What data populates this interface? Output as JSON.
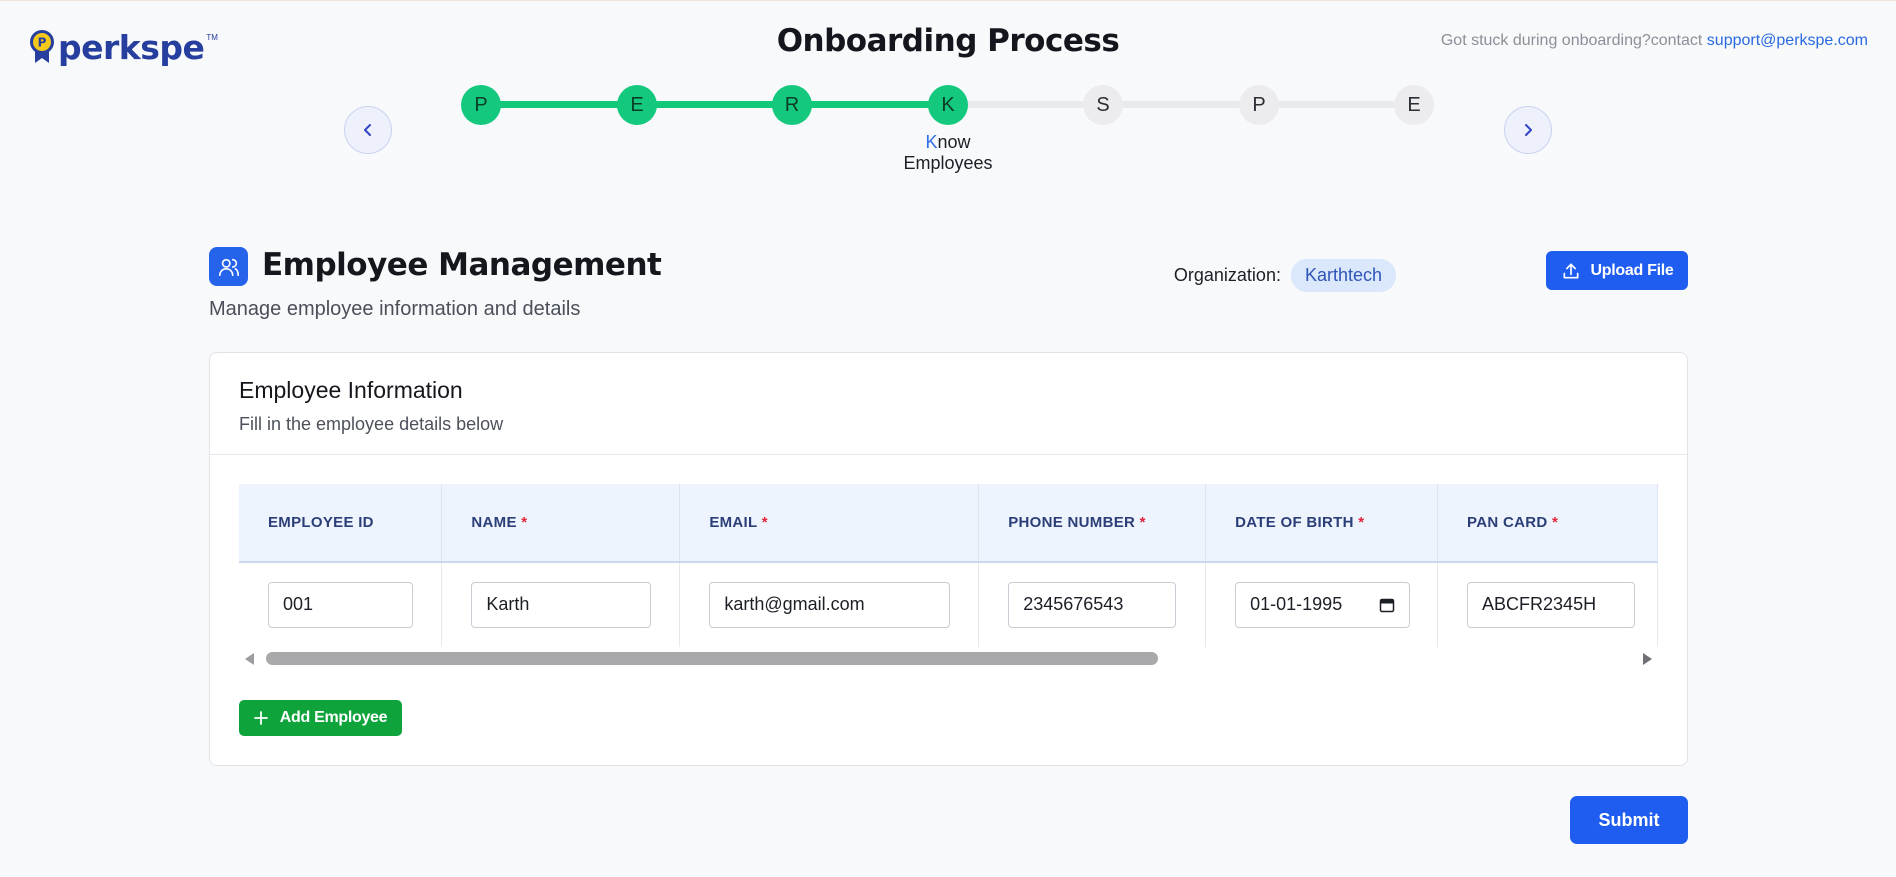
{
  "brand": {
    "logo_text": "perkspe",
    "logo_tm": "TM",
    "badge_letter": "P"
  },
  "header": {
    "title": "Onboarding Process",
    "help_text": "Got stuck during onboarding?contact ",
    "help_email": "support@perkspe.com"
  },
  "stepper": {
    "steps": [
      {
        "letter": "P",
        "status": "done"
      },
      {
        "letter": "E",
        "status": "done"
      },
      {
        "letter": "R",
        "status": "done"
      },
      {
        "letter": "K",
        "status": "current"
      },
      {
        "letter": "S",
        "status": "pending"
      },
      {
        "letter": "P",
        "status": "pending"
      },
      {
        "letter": "E",
        "status": "pending"
      }
    ],
    "current_caption_first": "K",
    "current_caption_rest": "now",
    "current_caption_line2": "Employees"
  },
  "section": {
    "title": "Employee Management",
    "subtitle": "Manage employee information and details",
    "org_label": "Organization:",
    "org_name": "Karthtech",
    "upload_label": "Upload File"
  },
  "card": {
    "title": "Employee Information",
    "subtitle": "Fill in the employee details below"
  },
  "table": {
    "columns": [
      {
        "label": "EMPLOYEE ID",
        "required": false
      },
      {
        "label": "NAME",
        "required": true
      },
      {
        "label": "EMAIL",
        "required": true
      },
      {
        "label": "PHONE NUMBER",
        "required": true
      },
      {
        "label": "DATE OF BIRTH",
        "required": true
      },
      {
        "label": "PAN CARD",
        "required": true
      }
    ],
    "required_mark": "*",
    "rows": [
      {
        "employee_id": "001",
        "name": "Karth",
        "email": "karth@gmail.com",
        "phone": "2345676543",
        "dob": "01-01-1995",
        "pan": "ABCFR2345H"
      }
    ]
  },
  "actions": {
    "add_employee": "Add Employee",
    "submit": "Submit"
  },
  "colors": {
    "primary": "#1e5df0",
    "success": "#0fa33c",
    "step_done": "#14c97d",
    "brand": "#263e9e"
  }
}
